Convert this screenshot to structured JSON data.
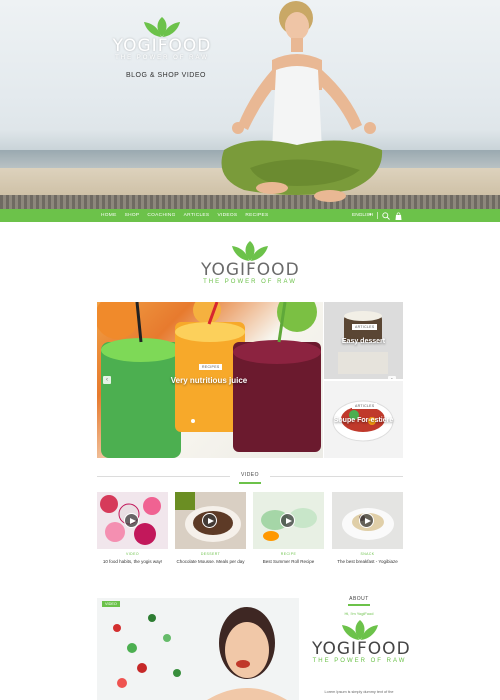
{
  "brand": {
    "name": "YOGIFOOD",
    "tagline": "THE POWER OF RAW",
    "accent": "#6cc24a"
  },
  "hero": {
    "subtitle": "BLOG & SHOP VIDEO"
  },
  "nav": {
    "items": [
      {
        "label": "HOME"
      },
      {
        "label": "SHOP"
      },
      {
        "label": "COACHING"
      },
      {
        "label": "ARTICLES"
      },
      {
        "label": "VIDEOS"
      },
      {
        "label": "RECIPES"
      }
    ],
    "language": "ENGLISH",
    "language_chevron": "▾",
    "search_icon": "search-icon",
    "cart_icon": "shopping-bag-icon"
  },
  "featured": {
    "main": {
      "badge": "RECIPES",
      "title": "Very nutritious juice"
    },
    "side": [
      {
        "badge": "ARTICLES",
        "title": "Easy dessert"
      },
      {
        "badge": "ARTICLES",
        "title": "Soupe For-estière"
      }
    ],
    "prev_icon": "arrow-left-icon",
    "next_icon": "arrow-right-icon"
  },
  "video_section": {
    "heading": "VIDEO",
    "items": [
      {
        "category": "VIDEO",
        "title": "10 food habits, the yogis way!"
      },
      {
        "category": "DESSERT",
        "title": "Chocolate Mousse. Meals per day"
      },
      {
        "category": "RECIPE",
        "title": "Best Summer Roll Recipe"
      },
      {
        "category": "SNACK",
        "title": "The best breakfast - Yogibiaze"
      }
    ]
  },
  "bottom": {
    "video_tag": "VIDEO",
    "about_heading": "ABOUT",
    "about_greeting": "Hi, I'm YogiFood",
    "about_text": "Lorem Ipsum is simply dummy text of the"
  }
}
